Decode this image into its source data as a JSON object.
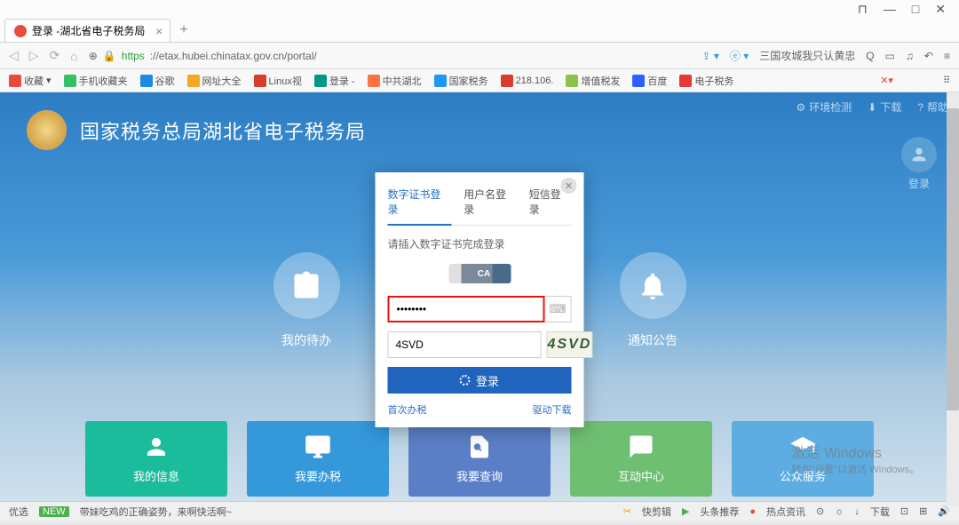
{
  "window": {
    "controls": [
      "⊓",
      "—",
      "□",
      "✕"
    ]
  },
  "tab": {
    "title": "登录 -湖北省电子税务局"
  },
  "address": {
    "scheme": "https",
    "url": "://etax.hubei.chinatax.gov.cn/portal/",
    "search_hint": "三国攻城我只认黄忠"
  },
  "bookmarks": {
    "left": [
      "收藏",
      "手机收藏夹",
      "谷歌",
      "网址大全",
      "Linux视",
      "登录 -",
      "中共湖北",
      "国家税务",
      "218.106.",
      "增值税发",
      "百度",
      "电子税务"
    ],
    "colors": [
      "#e74c3c",
      "#35c065",
      "#1e88e5",
      "#f5a623",
      "#d73c2c",
      "#009688",
      "#ff7043",
      "#2196f3",
      "#d73c2c",
      "#8bc34a",
      "#2962ff",
      "#e53935"
    ]
  },
  "page": {
    "top_links": [
      "环境检测",
      "下载",
      "帮助"
    ],
    "title": "国家税务总局湖北省电子税务局",
    "login_label": "登录",
    "icon_items": [
      "我的待办",
      "通知公告"
    ],
    "cards": [
      {
        "label": "我的信息",
        "color": "#1abc9c"
      },
      {
        "label": "我要办税",
        "color": "#3498db"
      },
      {
        "label": "我要查询",
        "color": "#5b7fc7"
      },
      {
        "label": "互动中心",
        "color": "#6fbf73"
      },
      {
        "label": "公众服务",
        "color": "#5dade2"
      }
    ]
  },
  "modal": {
    "tabs": [
      "数字证书登录",
      "用户名登录",
      "短信登录"
    ],
    "active_tab": 0,
    "hint": "请插入数字证书完成登录",
    "ca_label": "CA",
    "password_value": "••••••••",
    "captcha_value": "4SVD",
    "captcha_image": "4SVD",
    "login_button": "登录",
    "bottom_links": [
      "首次办税",
      "驱动下载"
    ]
  },
  "watermark": {
    "line1": "激活 Windows",
    "line2": "转到\"设置\"以激活 Windows。"
  },
  "status": {
    "left_items": [
      "优选",
      "带妹吃鸡的正确姿势，来啊快活啊~"
    ],
    "right_items": [
      "快剪辑",
      "头条推荐",
      "热点资讯",
      "下载"
    ]
  }
}
